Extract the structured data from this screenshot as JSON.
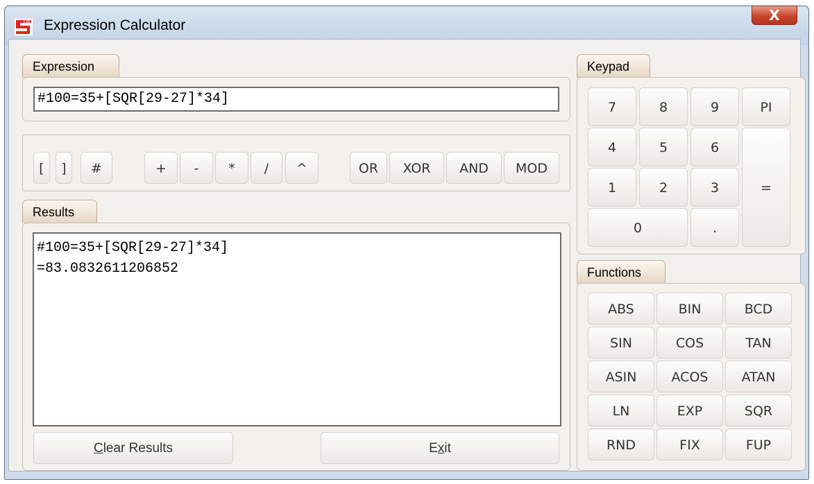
{
  "window": {
    "title": "Expression Calculator",
    "close_label": "X"
  },
  "expression": {
    "tab": "Expression",
    "value": "#100=35+[SQR[29-27]*34]"
  },
  "operators": [
    {
      "label": "["
    },
    {
      "label": "]"
    },
    {
      "label": "#"
    },
    {
      "label": "+"
    },
    {
      "label": "-"
    },
    {
      "label": "*"
    },
    {
      "label": "/"
    },
    {
      "label": "^"
    },
    {
      "label": "OR"
    },
    {
      "label": "XOR"
    },
    {
      "label": "AND"
    },
    {
      "label": "MOD"
    }
  ],
  "results": {
    "tab": "Results",
    "lines": [
      "#100=35+[SQR[29-27]*34]",
      "=83.0832611206852"
    ],
    "clear_first": "C",
    "clear_rest": "lear Results",
    "exit_pre": "E",
    "exit_ul": "x",
    "exit_rest": "it"
  },
  "keypad": {
    "tab": "Keypad",
    "keys": [
      "7",
      "8",
      "9",
      "PI",
      "4",
      "5",
      "6",
      "1",
      "2",
      "3",
      "=",
      "0",
      "."
    ]
  },
  "functions": {
    "tab": "Functions",
    "keys": [
      "ABS",
      "BIN",
      "BCD",
      "SIN",
      "COS",
      "TAN",
      "ASIN",
      "ACOS",
      "ATAN",
      "LN",
      "EXP",
      "SQR",
      "RND",
      "FIX",
      "FUP"
    ]
  }
}
